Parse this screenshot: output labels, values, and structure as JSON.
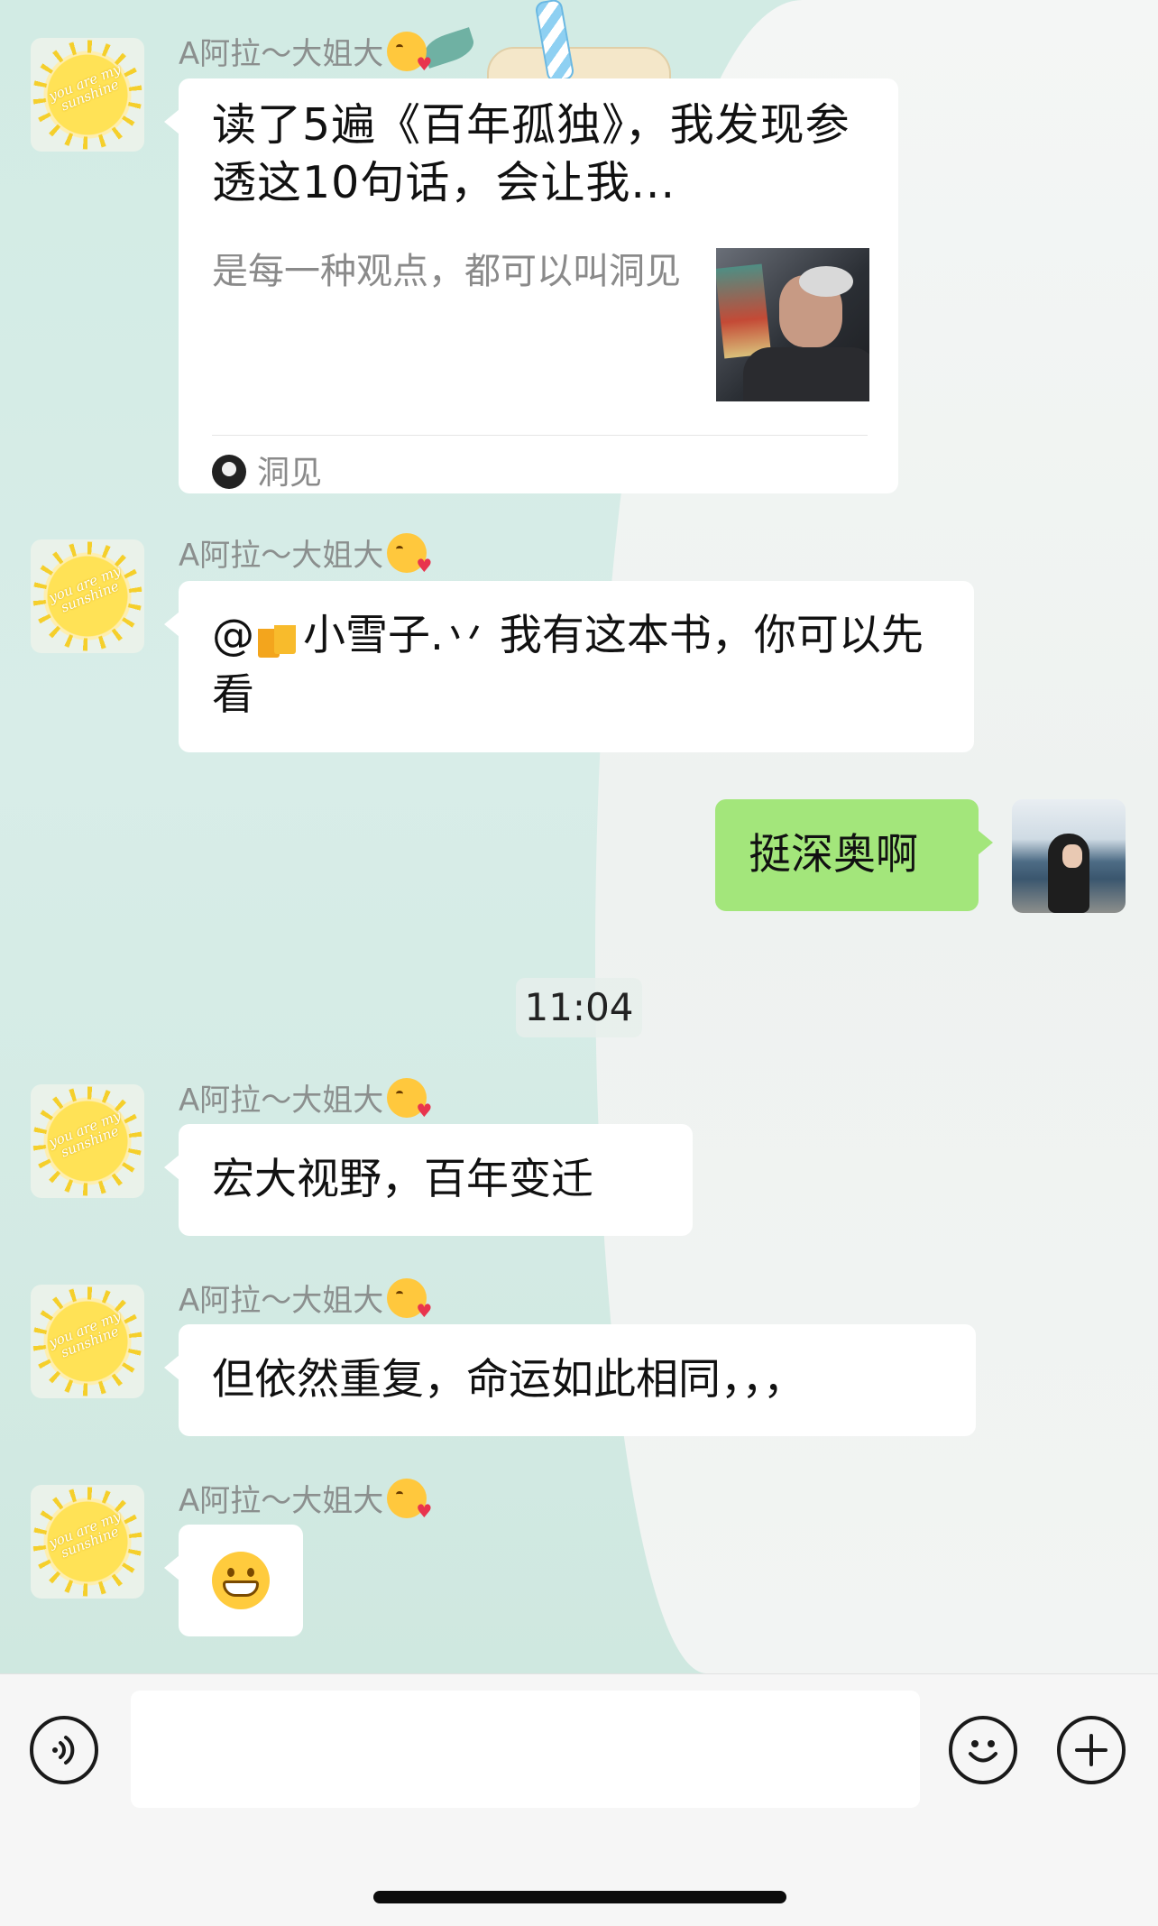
{
  "chat": {
    "messages": [
      {
        "type": "link",
        "sender": "A阿拉～大姐大",
        "title": "读了5遍《百年孤独》，我发现参透这10句话，会让我...",
        "description": "是每一种观点，都可以叫洞见",
        "source": "洞见"
      },
      {
        "type": "text",
        "sender": "A阿拉～大姐大",
        "mention": "@",
        "mention_name": "小雪子.丷",
        "text": " 我有这本书，你可以先看"
      },
      {
        "type": "text",
        "sender": "me",
        "text": "挺深奥啊"
      },
      {
        "type": "time",
        "text": "11:04"
      },
      {
        "type": "text",
        "sender": "A阿拉～大姐大",
        "text": "宏大视野，百年变迁"
      },
      {
        "type": "text",
        "sender": "A阿拉～大姐大",
        "text": "但依然重复，命运如此相同，，，"
      },
      {
        "type": "emoji",
        "sender": "A阿拉～大姐大",
        "emoji_name": "grinning-face"
      }
    ]
  },
  "avatar_text": "you are my sunshine",
  "input_bar": {
    "placeholder": "",
    "voice_icon": "voice-icon",
    "emoji_icon": "emoji-icon",
    "plus_icon": "plus-icon"
  },
  "colors": {
    "my_bubble": "#a3e67b",
    "other_bubble": "#ffffff",
    "sender_name": "#8b8f8e"
  }
}
